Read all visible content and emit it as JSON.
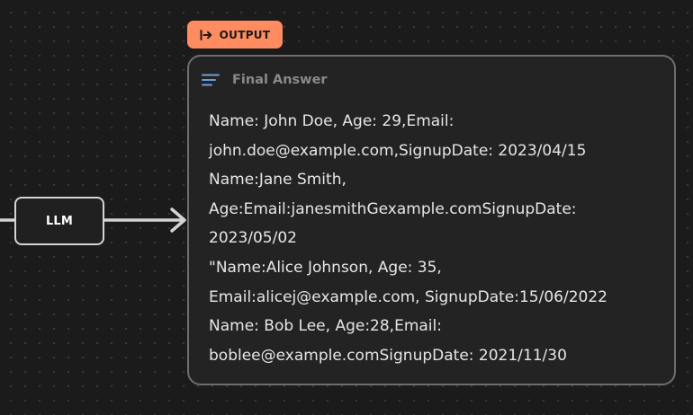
{
  "llm_node": {
    "label": "LLM"
  },
  "output_badge": {
    "label": "OUTPUT",
    "icon": "arrow-to-bar-icon"
  },
  "answer_card": {
    "header": {
      "icon": "lines-left-align-icon",
      "title": "Final Answer"
    },
    "lines": [
      "Name: John Doe, Age: 29,Email:",
      "john.doe@example.com,SignupDate: 2023/04/15",
      "Name:Jane Smith,",
      "Age:Email:janesmithGexample.comSignupDate:",
      "2023/05/02",
      "\"Name:Alice Johnson, Age: 35,",
      "Email:alicej@example.com, SignupDate:15/06/2022",
      "Name: Bob Lee, Age:28,Email:",
      "boblee@example.comSignupDate: 2021/11/30"
    ]
  },
  "colors": {
    "background": "#1b1b1b",
    "badge": "#ff8b60",
    "card_border": "#6e6e6e",
    "edge": "#d4d4d4"
  }
}
